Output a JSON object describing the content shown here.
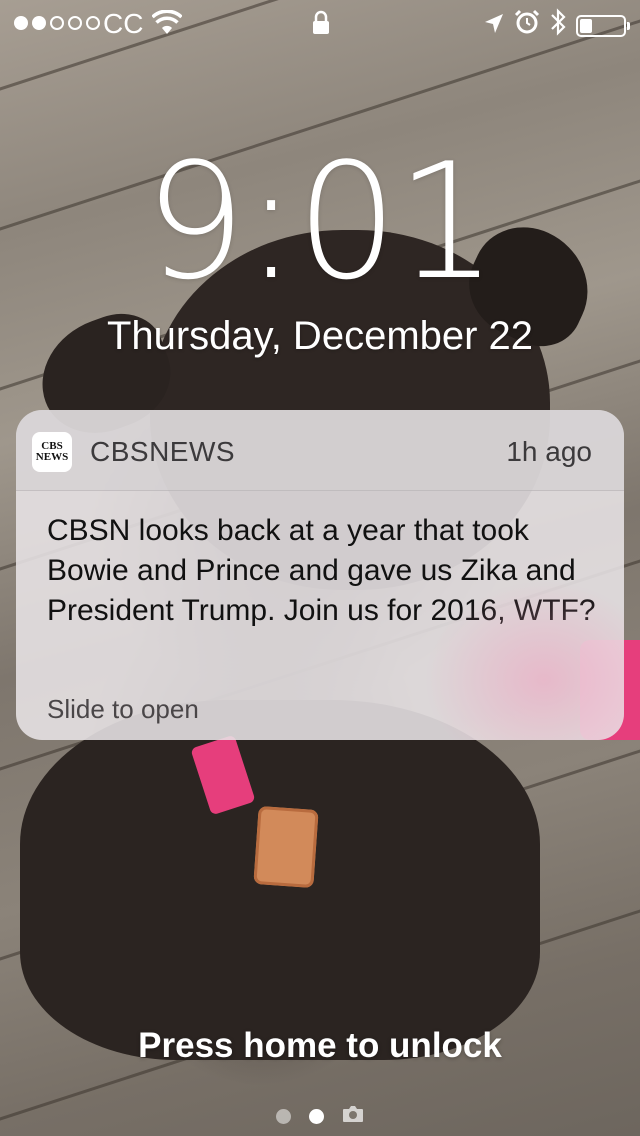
{
  "status_bar": {
    "carrier": "CC",
    "signal_bars_filled": 2,
    "signal_bars_total": 5,
    "battery_level": 0.28,
    "icons": [
      "wifi-icon",
      "lock-icon",
      "location-icon",
      "alarm-icon",
      "bluetooth-icon",
      "battery-icon"
    ]
  },
  "lock_screen": {
    "time": "9:01",
    "date": "Thursday, December 22"
  },
  "notification": {
    "app_name": "CBSNEWS",
    "app_icon_text": "CBS NEWS",
    "time_ago": "1h ago",
    "body": "CBSN looks back at a year that took Bowie and Prince and gave us Zika and President Trump. Join us for 2016, WTF?",
    "action": "Slide to open"
  },
  "bottom": {
    "unlock_hint": "Press home to unlock",
    "page_indicator": {
      "pages": 2,
      "active_page": 2,
      "extra_icon": "camera-icon"
    }
  },
  "colors": {
    "accent_collar": "#e63e7c",
    "text_primary": "#ffffff",
    "notification_bg": "#e8e4e6"
  }
}
